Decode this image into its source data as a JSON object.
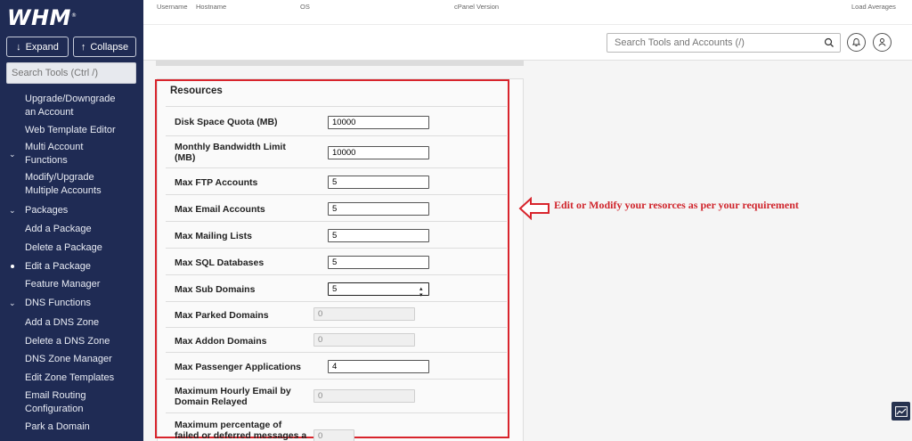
{
  "brand": {
    "logo": "WHM",
    "tm": "®"
  },
  "sidebar": {
    "expand_label": "Expand",
    "collapse_label": "Collapse",
    "search_placeholder": "Search Tools (Ctrl /)",
    "items": [
      {
        "label_line1": "Upgrade/Downgrade",
        "label_line2": "an Account"
      },
      {
        "label_line1": "Web Template Editor"
      },
      {
        "label_line1": "Multi Account",
        "label_line2": "Functions"
      },
      {
        "label_line1": "Modify/Upgrade",
        "label_line2": "Multiple Accounts"
      },
      {
        "label_line1": "Packages"
      },
      {
        "label_line1": "Add a Package"
      },
      {
        "label_line1": "Delete a Package"
      },
      {
        "label_line1": "Edit a Package"
      },
      {
        "label_line1": "Feature Manager"
      },
      {
        "label_line1": "DNS Functions"
      },
      {
        "label_line1": "Add a DNS Zone"
      },
      {
        "label_line1": "Delete a DNS Zone"
      },
      {
        "label_line1": "DNS Zone Manager"
      },
      {
        "label_line1": "Edit Zone Templates"
      },
      {
        "label_line1": "Email Routing",
        "label_line2": "Configuration"
      },
      {
        "label_line1": "Park a Domain"
      }
    ]
  },
  "topbar": {
    "username": "Username",
    "hostname": "Hostname",
    "os": "OS",
    "cpanel_version": "cPanel Version",
    "load_averages": "Load Averages"
  },
  "header": {
    "search_placeholder": "Search Tools and Accounts (/)"
  },
  "resources": {
    "title": "Resources",
    "rows": [
      {
        "label": "Disk Space Quota (MB)",
        "value": "10000"
      },
      {
        "label": "Monthly Bandwidth Limit",
        "label2": "(MB)",
        "value": "10000"
      },
      {
        "label": "Max FTP Accounts",
        "value": "5"
      },
      {
        "label": "Max Email Accounts",
        "value": "5"
      },
      {
        "label": "Max Mailing Lists",
        "value": "5"
      },
      {
        "label": "Max SQL Databases",
        "value": "5"
      },
      {
        "label": "Max Sub Domains",
        "value": "5"
      },
      {
        "label": "Max Parked Domains",
        "value": "0"
      },
      {
        "label": "Max Addon Domains",
        "value": "0"
      },
      {
        "label": "Max Passenger Applications",
        "value": "4"
      },
      {
        "label": "Maximum Hourly Email by",
        "label2": "Domain Relayed",
        "value": "0"
      },
      {
        "label": "Maximum percentage of",
        "label2": "failed or deferred messages a",
        "value": "0"
      }
    ]
  },
  "annotation": {
    "text": "Edit or Modify your resorces as per your requirement"
  },
  "colors": {
    "sidebar_bg": "#1f2b54",
    "highlight": "#d8242c",
    "annotation": "#d0262d"
  }
}
